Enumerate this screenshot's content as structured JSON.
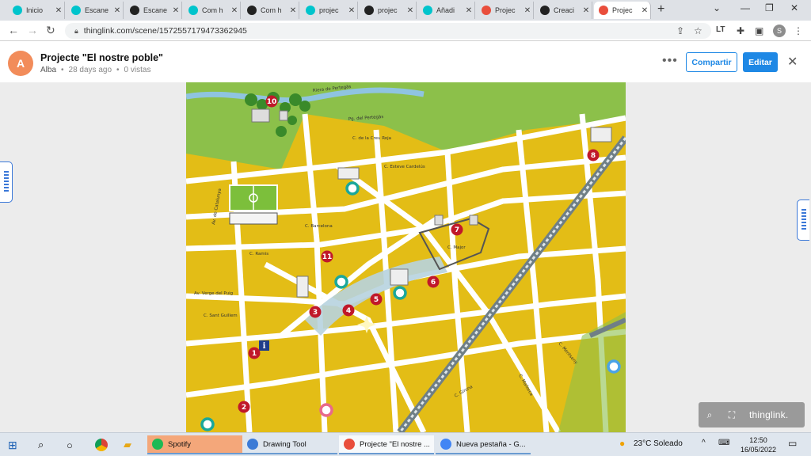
{
  "browser": {
    "tabs": [
      {
        "label": "Inicio",
        "icon": "canva-icon",
        "color": "#00c4cc"
      },
      {
        "label": "Escane",
        "icon": "canva-icon",
        "color": "#00c4cc"
      },
      {
        "label": "Escane",
        "icon": "github-icon",
        "color": "#222222"
      },
      {
        "label": "Com h",
        "icon": "canva-icon",
        "color": "#00c4cc"
      },
      {
        "label": "Com h",
        "icon": "github-icon",
        "color": "#222222"
      },
      {
        "label": "projec",
        "icon": "canva-icon",
        "color": "#00c4cc"
      },
      {
        "label": "projec",
        "icon": "github-icon",
        "color": "#222222"
      },
      {
        "label": "Añadi",
        "icon": "canva-icon",
        "color": "#00c4cc"
      },
      {
        "label": "Projec",
        "icon": "thinglink-icon",
        "color": "#e94e3c"
      },
      {
        "label": "Creaci",
        "icon": "github-icon",
        "color": "#222222"
      },
      {
        "label": "Projec",
        "icon": "thinglink-icon",
        "color": "#e94e3c"
      }
    ],
    "url": "thinglink.com/scene/1572557179473362945",
    "profile_initial": "S"
  },
  "scene": {
    "avatar_initial": "A",
    "title": "Projecte \"El nostre poble\"",
    "author": "Alba",
    "age": "28 days ago",
    "views": "0 vistas",
    "share_label": "Compartir",
    "edit_label": "Editar",
    "brand": "thinglink."
  },
  "map": {
    "street_labels": [
      "Riera de Pertegàs",
      "Pg. del Pertegàs",
      "C. de la Creu Roja",
      "C. Esteve Cardelús",
      "C. Barcelona",
      "C. Ramis",
      "Av. de Catalunya",
      "Av. Verge del Puig",
      "C. Sant Guillem",
      "C. Girona",
      "C. Montseny",
      "C. Mallorca",
      "C. Major"
    ],
    "numbered_markers": [
      "10",
      "8",
      "7",
      "11",
      "6",
      "5",
      "4",
      "3",
      "1",
      "2"
    ],
    "accent_red": "#c0182a",
    "hotspot_teal": "#1aa79b",
    "hotspot_blue": "#4aa3e8",
    "hotspot_pink": "#e86a8a"
  },
  "taskbar": {
    "apps": [
      {
        "label": "Spotify",
        "color": "#1db954"
      },
      {
        "label": "Drawing Tool",
        "color": "#3c7bd6"
      },
      {
        "label": "Projecte \"El nostre ...",
        "color": "#e94e3c"
      },
      {
        "label": "Nueva pestaña - G...",
        "color": "#4285f4"
      }
    ],
    "weather": "23°C  Soleado",
    "time": "12:50",
    "date": "16/05/2022"
  }
}
